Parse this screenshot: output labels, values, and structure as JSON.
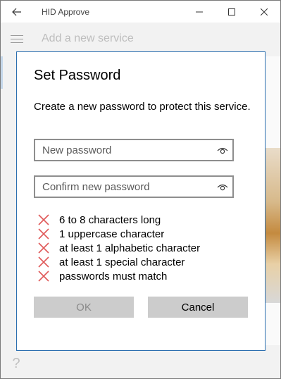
{
  "window": {
    "title": "HID Approve",
    "controls": {
      "minimize_icon": "minimize-icon",
      "maximize_icon": "maximize-icon",
      "close_icon": "close-icon"
    }
  },
  "app": {
    "page_header": "Add a new service",
    "help_glyph": "?"
  },
  "dialog": {
    "title": "Set Password",
    "description": "Create a new password to protect this service.",
    "new_password": {
      "placeholder": "New password",
      "value": ""
    },
    "confirm_password": {
      "placeholder": "Confirm new password",
      "value": ""
    },
    "requirements": [
      {
        "label": "6 to 8 characters long",
        "met": false
      },
      {
        "label": "1 uppercase character",
        "met": false
      },
      {
        "label": "at least 1 alphabetic character",
        "met": false
      },
      {
        "label": "at least 1 special character",
        "met": false
      },
      {
        "label": "passwords must match",
        "met": false
      }
    ],
    "ok_label": "OK",
    "ok_enabled": false,
    "cancel_label": "Cancel"
  },
  "colors": {
    "dialog_border": "#2b6fb0",
    "unmet_mark": "#e05a5a",
    "button_bg": "#cccccc",
    "disabled_text": "#8a8a8a"
  }
}
